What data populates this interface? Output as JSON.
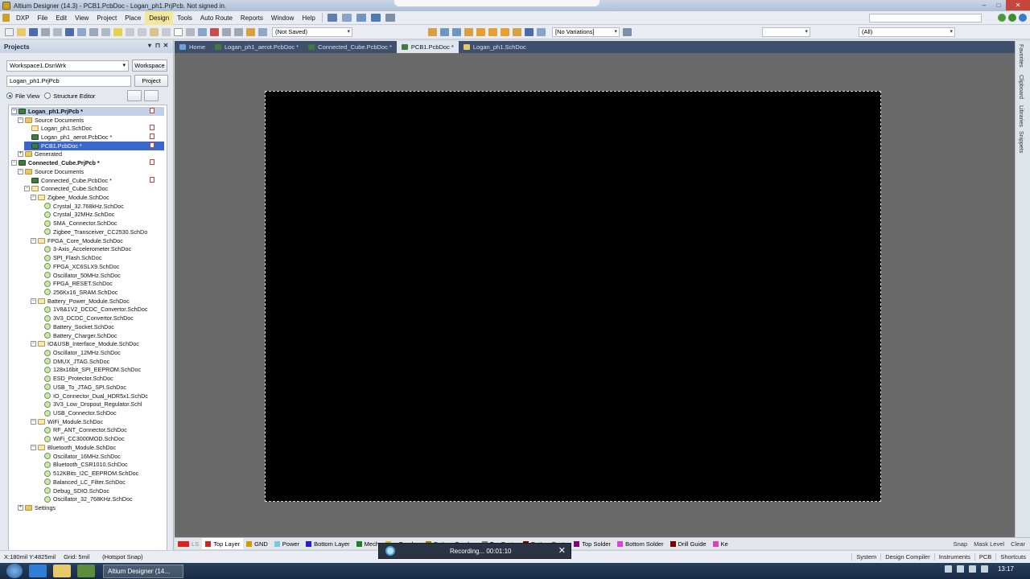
{
  "window": {
    "title": "Altium Designer (14.3) - PCB1.PcbDoc - Logan_ph1.PrjPcb. Not signed in.",
    "controls": [
      "–",
      "□",
      "✕"
    ]
  },
  "menu": [
    "DXP",
    "File",
    "Edit",
    "View",
    "Project",
    "Place",
    "Design",
    "Tools",
    "Auto Route",
    "Reports",
    "Window",
    "Help"
  ],
  "toolbar": {
    "saved_status": "(Not Saved)",
    "variations": "[No Variations]",
    "filter_all": "(All)"
  },
  "projects_panel": {
    "title": "Projects",
    "header_controls": [
      "▾",
      "⊓",
      "✕"
    ],
    "workspace_combo": "Workspace1.DsnWrk",
    "workspace_button": "Workspace",
    "project_field": "Logan_ph1.PrjPcb",
    "project_button": "Project",
    "view_file": "File View",
    "view_structure": "Structure Editor",
    "tree": [
      {
        "label": "Logan_ph1.PrjPcb *",
        "level": 0,
        "kind": "project",
        "exp": "−",
        "bold": true,
        "highlight": "project",
        "mark": true
      },
      {
        "label": "Source Documents",
        "level": 1,
        "kind": "folder",
        "exp": "−"
      },
      {
        "label": "Logan_ph1.SchDoc",
        "level": 2,
        "kind": "sch",
        "mark": true
      },
      {
        "label": "Logan_ph1_aerot.PcbDoc *",
        "level": 2,
        "kind": "pcb",
        "mark": true
      },
      {
        "label": "PCB1.PcbDoc *",
        "level": 2,
        "kind": "pcb",
        "highlight": "selected",
        "mark": true
      },
      {
        "label": "Generated",
        "level": 1,
        "kind": "folder",
        "exp": "+"
      },
      {
        "label": "Connected_Cube.PrjPcb *",
        "level": 0,
        "kind": "project",
        "exp": "−",
        "bold": true,
        "mark": true
      },
      {
        "label": "Source Documents",
        "level": 1,
        "kind": "folder",
        "exp": "−"
      },
      {
        "label": "Connected_Cube.PcbDoc *",
        "level": 2,
        "kind": "pcb",
        "mark": true
      },
      {
        "label": "Connected_Cube.SchDoc",
        "level": 2,
        "kind": "sch",
        "exp": "−"
      },
      {
        "label": "Zigbee_Module.SchDoc",
        "level": 3,
        "kind": "sch",
        "exp": "−"
      },
      {
        "label": "Crystal_32.768kHz.SchDoc",
        "level": 4,
        "kind": "sub"
      },
      {
        "label": "Crystal_32MHz.SchDoc",
        "level": 4,
        "kind": "sub"
      },
      {
        "label": "SMA_Connector.SchDoc",
        "level": 4,
        "kind": "sub"
      },
      {
        "label": "Zigbee_Transceiver_CC2530.SchDo",
        "level": 4,
        "kind": "sub"
      },
      {
        "label": "FPGA_Core_Module.SchDoc",
        "level": 3,
        "kind": "sch",
        "exp": "−"
      },
      {
        "label": "3-Axis_Accelerometer.SchDoc",
        "level": 4,
        "kind": "sub"
      },
      {
        "label": "SPI_Flash.SchDoc",
        "level": 4,
        "kind": "sub"
      },
      {
        "label": "FPGA_XC6SLX9.SchDoc",
        "level": 4,
        "kind": "sub"
      },
      {
        "label": "Oscillator_50MHz.SchDoc",
        "level": 4,
        "kind": "sub"
      },
      {
        "label": "FPGA_RESET.SchDoc",
        "level": 4,
        "kind": "sub"
      },
      {
        "label": "256Kx16_SRAM.SchDoc",
        "level": 4,
        "kind": "sub"
      },
      {
        "label": "Battery_Power_Module.SchDoc",
        "level": 3,
        "kind": "sch",
        "exp": "−"
      },
      {
        "label": "1V8&1V2_DCDC_Convertor.SchDoc",
        "level": 4,
        "kind": "sub"
      },
      {
        "label": "3V3_DCDC_Convertor.SchDoc",
        "level": 4,
        "kind": "sub"
      },
      {
        "label": "Battery_Socket.SchDoc",
        "level": 4,
        "kind": "sub"
      },
      {
        "label": "Battery_Charger.SchDoc",
        "level": 4,
        "kind": "sub"
      },
      {
        "label": "IO&USB_Interface_Module.SchDoc",
        "level": 3,
        "kind": "sch",
        "exp": "−"
      },
      {
        "label": "Oscillator_12MHz.SchDoc",
        "level": 4,
        "kind": "sub"
      },
      {
        "label": "DMUX_JTAG.SchDoc",
        "level": 4,
        "kind": "sub"
      },
      {
        "label": "128x16bit_SPI_EEPROM.SchDoc",
        "level": 4,
        "kind": "sub"
      },
      {
        "label": "ESD_Protector.SchDoc",
        "level": 4,
        "kind": "sub"
      },
      {
        "label": "USB_To_JTAG_SPI.SchDoc",
        "level": 4,
        "kind": "sub"
      },
      {
        "label": "IO_Connector_Dual_HDR5x1.SchDc",
        "level": 4,
        "kind": "sub"
      },
      {
        "label": "3V3_Low_Dropout_Regulator.Schl",
        "level": 4,
        "kind": "sub"
      },
      {
        "label": "USB_Connector.SchDoc",
        "level": 4,
        "kind": "sub"
      },
      {
        "label": "WiFi_Module.SchDoc",
        "level": 3,
        "kind": "sch",
        "exp": "−"
      },
      {
        "label": "RF_ANT_Connector.SchDoc",
        "level": 4,
        "kind": "sub"
      },
      {
        "label": "WiFi_CC3000MOD.SchDoc",
        "level": 4,
        "kind": "sub"
      },
      {
        "label": "Bluetooth_Module.SchDoc",
        "level": 3,
        "kind": "sch",
        "exp": "−"
      },
      {
        "label": "Oscillator_16MHz.SchDoc",
        "level": 4,
        "kind": "sub"
      },
      {
        "label": "Bluetooth_CSR1010.SchDoc",
        "level": 4,
        "kind": "sub"
      },
      {
        "label": "512KBits_I2C_EEPROM.SchDoc",
        "level": 4,
        "kind": "sub"
      },
      {
        "label": "Balanced_LC_Filter.SchDoc",
        "level": 4,
        "kind": "sub"
      },
      {
        "label": "Debug_SDIO.SchDoc",
        "level": 4,
        "kind": "sub"
      },
      {
        "label": "Oscillator_32_768KHz.SchDoc",
        "level": 4,
        "kind": "sub"
      },
      {
        "label": "Settings",
        "level": 1,
        "kind": "folder",
        "exp": "+"
      }
    ],
    "bottom_tabs": [
      "Files",
      "Projects",
      "Navigator",
      "PCB",
      "PCB Filter"
    ],
    "active_bottom_tab": "Projects"
  },
  "doc_tabs": [
    {
      "label": "Home",
      "icon_color": "#6aa4e0",
      "active": false
    },
    {
      "label": "Logan_ph1_aerot.PcbDoc *",
      "icon_color": "#3f7b3f",
      "active": false
    },
    {
      "label": "Connected_Cube.PcbDoc *",
      "icon_color": "#3f7b3f",
      "active": false
    },
    {
      "label": "PCB1.PcbDoc *",
      "icon_color": "#3f7b3f",
      "active": true
    },
    {
      "label": "Logan_ph1.SchDoc",
      "icon_color": "#e7c96b",
      "active": false
    }
  ],
  "right_panels": [
    "Favorites",
    "Clipboard",
    "Libraries",
    "Snippets"
  ],
  "layers": [
    {
      "label": "LS",
      "color": "#e0201c"
    },
    {
      "label": "Top Layer",
      "color": "#e0201c",
      "active": true
    },
    {
      "label": "GND",
      "color": "#c8a000"
    },
    {
      "label": "Power",
      "color": "#78c8e0"
    },
    {
      "label": "Bottom Layer",
      "color": "#2020d0"
    },
    {
      "label": "Mech",
      "color": "#208020"
    },
    {
      "label": "p Overlay",
      "color": "#c8c800"
    },
    {
      "label": "Bottom Overlay",
      "color": "#a08000"
    },
    {
      "label": "Top Paste",
      "color": "#808080"
    },
    {
      "label": "Bottom Paste",
      "color": "#800000"
    },
    {
      "label": "Top Solder",
      "color": "#800080"
    },
    {
      "label": "Bottom Solder",
      "color": "#e040e0"
    },
    {
      "label": "Drill Guide",
      "color": "#800000"
    },
    {
      "label": "Ke",
      "color": "#e040c0"
    }
  ],
  "layerbar_right": [
    "Snap",
    "Mask Level",
    "Clear"
  ],
  "recording": {
    "text": "Recording... 00:01:10",
    "close": "✕"
  },
  "status": {
    "coords": "X:180mil Y:4825mil",
    "grid": "Grid: 5mil",
    "snap": "(Hotspot Snap)",
    "right": [
      "System",
      "Design Compiler",
      "Instruments",
      "PCB",
      "Shortcuts"
    ]
  },
  "taskbar": {
    "task_label": "Altium Designer (14...",
    "clock": "13:17"
  }
}
